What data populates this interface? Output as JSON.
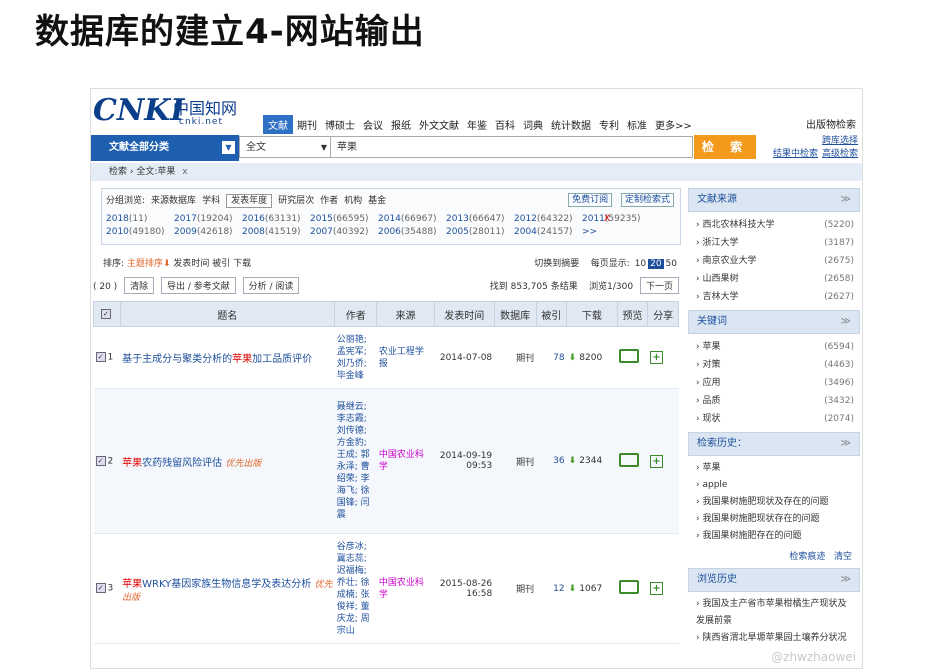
{
  "slide_title": "数据库的建立4-网站输出",
  "logo": {
    "brand": "CNKI",
    "cn": "中国知网",
    "net": "cnki.net"
  },
  "nav": {
    "items": [
      "文献",
      "期刊",
      "博硕士",
      "会议",
      "报纸",
      "外文文献",
      "年鉴",
      "百科",
      "词典",
      "统计数据",
      "专利",
      "标准",
      "更多>>"
    ],
    "active_index": 0,
    "pub_search": "出版物检索"
  },
  "search": {
    "category": "文献全部分类",
    "field": "全文",
    "query": "苹果",
    "button": "检 索",
    "link_cross_db": "跨库选择",
    "link_in_results": "结果中检索",
    "link_advanced": "高级检索"
  },
  "breadcrumb": {
    "home": "检索",
    "sep": "›",
    "current": "全文:苹果",
    "close": "x"
  },
  "filter": {
    "label": "分组浏览:",
    "tabs": [
      "来源数据库",
      "学科",
      "发表年度",
      "研究层次",
      "作者",
      "机构",
      "基金"
    ],
    "selected_tab": 2,
    "free_subscribe": "免费订阅",
    "custom_search": "定制检索式",
    "years": [
      {
        "y": "2018",
        "n": "(11)"
      },
      {
        "y": "2017",
        "n": "(19204)"
      },
      {
        "y": "2016",
        "n": "(63131)"
      },
      {
        "y": "2015",
        "n": "(66595)"
      },
      {
        "y": "2014",
        "n": "(66967)"
      },
      {
        "y": "2013",
        "n": "(66647)"
      },
      {
        "y": "2012",
        "n": "(64322)"
      },
      {
        "y": "2011",
        "n": "(59235)"
      },
      {
        "y": "2010",
        "n": "(49180)"
      },
      {
        "y": "2009",
        "n": "(42618)"
      },
      {
        "y": "2008",
        "n": "(41519)"
      },
      {
        "y": "2007",
        "n": "(40392)"
      },
      {
        "y": "2006",
        "n": "(35488)"
      },
      {
        "y": "2005",
        "n": "(28011)"
      },
      {
        "y": "2004",
        "n": "(24157)"
      },
      {
        "y": ">>",
        "n": ""
      }
    ],
    "close": "X"
  },
  "sort": {
    "label": "排序:",
    "by_topic": "主题排序",
    "by_date": "发表时间",
    "by_cite": "被引",
    "by_download": "下载",
    "switch_abstract": "切换到摘要",
    "per_page_label": "每页显示:",
    "page_sizes": [
      "10",
      "20",
      "50"
    ],
    "current_size": "20"
  },
  "actions": {
    "count_prefix": "( 20 )",
    "clear": "清除",
    "export": "导出 / 参考文献",
    "analyze": "分析 / 阅读",
    "found": "找到 853,705 条结果",
    "browse": "浏览1/300",
    "next": "下一页"
  },
  "table": {
    "headers": [
      "题名",
      "作者",
      "来源",
      "发表时间",
      "数据库",
      "被引",
      "下载",
      "预览",
      "分享"
    ],
    "rows": [
      {
        "no": "1",
        "title_pre": "基于主成分与聚类分析的",
        "title_kw": "苹果",
        "title_post": "加工品质评价",
        "prior": "",
        "authors": "公丽艳; 孟宪军; 刘乃侨; 毕金峰",
        "source": "农业工程学报",
        "date": "2014-07-08",
        "time": "",
        "db": "期刊",
        "cite": "78",
        "downloads": "8200"
      },
      {
        "no": "2",
        "title_pre": "",
        "title_kw": "苹果",
        "title_post": "农药残留风险评估",
        "prior": "优先出版",
        "authors": "聂继云; 李志霞; 刘传德; 方金豹; 王成; 郭永泽; 曹绍荣; 李海飞; 徐国锋; 闫震",
        "source": "中国农业科学",
        "date": "2014-09-19",
        "time": "09:53",
        "db": "期刊",
        "cite": "36",
        "downloads": "2344"
      },
      {
        "no": "3",
        "title_pre": "",
        "title_kw": "苹果",
        "title_post": "WRKY基因家族生物信息学及表达分析",
        "prior": "优先出版",
        "authors": "谷彦冰; 冀志蕊; 迟福梅; 乔壮; 徐成楠; 张俊祥; 董庆龙; 周宗山",
        "source": "中国农业科学",
        "date": "2015-08-26",
        "time": "16:58",
        "db": "期刊",
        "cite": "12",
        "downloads": "1067"
      }
    ]
  },
  "right_panel": {
    "source_title": "文献来源",
    "sources": [
      {
        "name": "西北农林科技大学",
        "count": "(5220)"
      },
      {
        "name": "浙江大学",
        "count": "(3187)"
      },
      {
        "name": "南京农业大学",
        "count": "(2675)"
      },
      {
        "name": "山西果树",
        "count": "(2658)"
      },
      {
        "name": "吉林大学",
        "count": "(2627)"
      }
    ],
    "keyword_title": "关键词",
    "keywords": [
      {
        "name": "苹果",
        "count": "(6594)"
      },
      {
        "name": "对策",
        "count": "(4463)"
      },
      {
        "name": "应用",
        "count": "(3496)"
      },
      {
        "name": "品质",
        "count": "(3432)"
      },
      {
        "name": "现状",
        "count": "(2074)"
      }
    ],
    "history_title": "检索历史：",
    "history": [
      "苹果",
      "apple",
      "我国果树施肥现状及存在的问题",
      "我国果树施肥现状存在的问题",
      "我国果树施肥存在的问题"
    ],
    "history_trace": "检索痕迹",
    "history_clear": "清空",
    "browse_title": "浏览历史",
    "browse": [
      "我国及主产省市苹果柑橘生产现状及发展前景",
      "陕西省渭北旱塬苹果园土壤养分状况"
    ]
  },
  "watermark": "@zhwzhaowei",
  "chevron": "≫"
}
